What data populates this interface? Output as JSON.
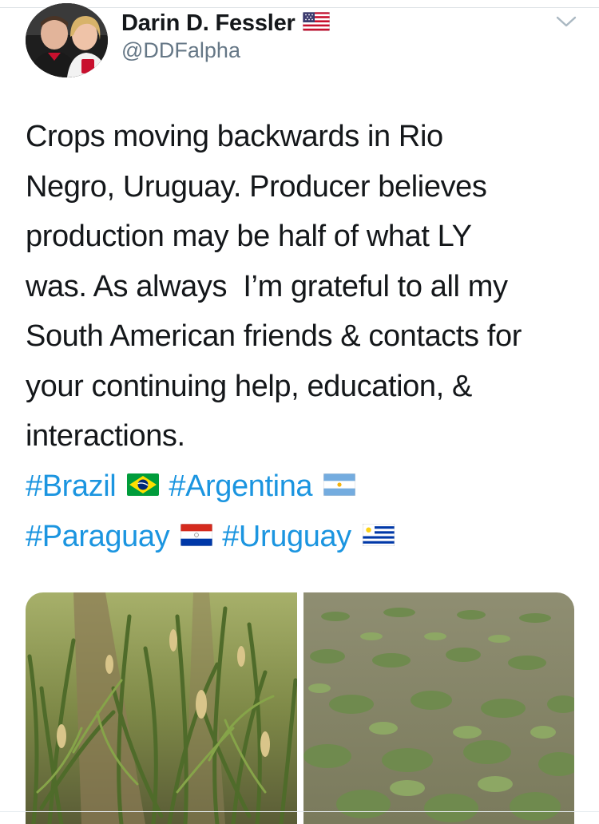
{
  "tweet": {
    "display_name": "Darin D. Fessler",
    "handle": "@DDFalpha",
    "author_flag_icon": "us-flag-icon",
    "menu_icon": "chevron-down-icon",
    "text": "Crops moving backwards in Rio\nNegro, Uruguay. Producer believes\nproduction may be half of what LY\nwas. As always  I’m grateful to all my\nSouth American friends & contacts for\nyour continuing help, education, &\ninteractions.",
    "hashtags": [
      {
        "tag": "#Brazil",
        "flag_icon": "brazil-flag-icon"
      },
      {
        "tag": "#Argentina",
        "flag_icon": "argentina-flag-icon"
      },
      {
        "tag": "#Paraguay",
        "flag_icon": "paraguay-flag-icon"
      },
      {
        "tag": "#Uruguay",
        "flag_icon": "uruguay-flag-icon"
      }
    ],
    "media": [
      {
        "kind": "photo",
        "subject": "corn-field"
      },
      {
        "kind": "photo",
        "subject": "soybean-field"
      }
    ]
  },
  "colors": {
    "link": "#1b95e0",
    "text": "#14171a",
    "secondary_text": "#657786"
  }
}
